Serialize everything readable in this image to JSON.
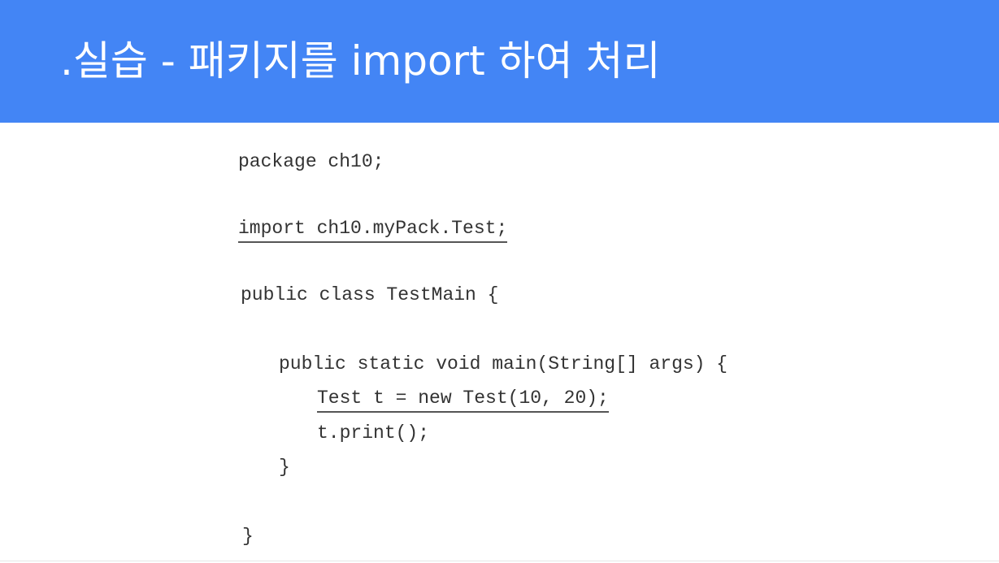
{
  "slide": {
    "title": ".실습 - 패키지를 import 하여 처리",
    "accent_color": "#4385f5",
    "code_lines": [
      "package ch10;",
      "import ch10.myPack.Test;",
      "public class TestMain {",
      "public static void main(String[] args) {",
      "Test t = new Test(10, 20);",
      "t.print();",
      "}",
      "}"
    ]
  }
}
